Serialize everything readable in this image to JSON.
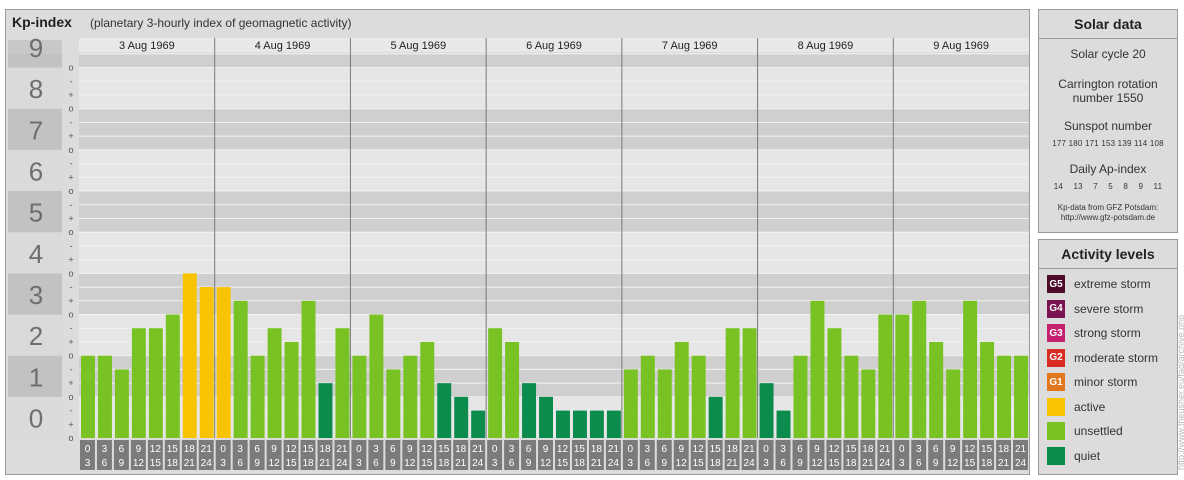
{
  "header": {
    "title": "Kp-index",
    "subtitle": "(planetary 3-hourly index of geomagnetic activity)"
  },
  "chart_data": {
    "type": "bar",
    "y_major_labels": [
      "0",
      "1",
      "2",
      "3",
      "4",
      "5",
      "6",
      "7",
      "8",
      "9"
    ],
    "y_minor_labels": [
      "o",
      "+",
      "-"
    ],
    "ylim": [
      0,
      9.33
    ],
    "days": [
      "3 Aug 1969",
      "4 Aug 1969",
      "5 Aug 1969",
      "6 Aug 1969",
      "7 Aug 1969",
      "8 Aug 1969",
      "9 Aug 1969"
    ],
    "interval_start_labels": [
      "0",
      "3",
      "6",
      "9",
      "12",
      "15",
      "18",
      "21"
    ],
    "interval_end_labels": [
      "3",
      "6",
      "9",
      "12",
      "15",
      "18",
      "21",
      "24"
    ],
    "values": [
      2.0,
      2.0,
      1.667,
      2.667,
      2.667,
      3.0,
      4.0,
      3.667,
      3.667,
      3.333,
      2.0,
      2.667,
      2.333,
      3.333,
      1.333,
      2.667,
      2.0,
      3.0,
      1.667,
      2.0,
      2.333,
      1.333,
      1.0,
      0.667,
      2.667,
      2.333,
      1.333,
      1.0,
      0.667,
      0.667,
      0.667,
      0.667,
      1.667,
      2.0,
      1.667,
      2.333,
      2.0,
      1.0,
      2.667,
      2.667,
      1.333,
      0.667,
      2.0,
      3.333,
      2.667,
      2.0,
      1.667,
      3.0,
      3.0,
      3.333,
      2.333,
      1.667,
      3.333,
      2.333,
      2.0,
      2.0
    ],
    "level_colors": {
      "quiet": "#0b8c4c",
      "unsettled": "#79c224",
      "active": "#f8c300"
    }
  },
  "solar": {
    "title": "Solar data",
    "cycle": "Solar cycle 20",
    "carrington_line1": "Carrington rotation",
    "carrington_line2": "number 1550",
    "sunspot_title": "Sunspot number",
    "sunspot_values": "177 180 171 153 139 114 108",
    "ap_title": "Daily Ap-index",
    "ap_values": "14 13 7 5 8 9 11",
    "credit_line1": "Kp-data from GFZ Potsdam:",
    "credit_line2": "http://www.gfz-potsdam.de"
  },
  "legend": {
    "title": "Activity levels",
    "items": [
      {
        "badge": "G5",
        "label": "extreme storm",
        "color": "#4e0a2a"
      },
      {
        "badge": "G4",
        "label": "severe storm",
        "color": "#7a1450"
      },
      {
        "badge": "G3",
        "label": "strong storm",
        "color": "#c4206e"
      },
      {
        "badge": "G2",
        "label": "moderate storm",
        "color": "#d82c24"
      },
      {
        "badge": "G1",
        "label": "minor storm",
        "color": "#e2761c"
      },
      {
        "badge": "",
        "label": "active",
        "color": "#f8c300"
      },
      {
        "badge": "",
        "label": "unsettled",
        "color": "#79c224"
      },
      {
        "badge": "",
        "label": "quiet",
        "color": "#0b8c4c"
      }
    ]
  },
  "watermark": "http://www.theusner.eu/faq/archive.php"
}
